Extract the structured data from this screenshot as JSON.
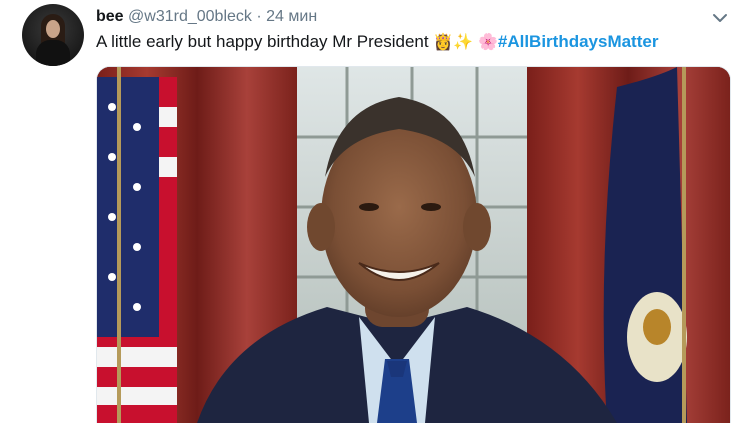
{
  "tweet": {
    "display_name": "bee",
    "handle": "@w31rd_00bleck",
    "separator": "·",
    "time": "24 мин",
    "text_prefix": "A little early but happy birthday Mr President",
    "emojis": [
      "👸",
      "✨",
      "🌸"
    ],
    "hashtag": "#AllBirthdaysMatter",
    "menu_icon": "chevron-down-icon",
    "media_description_icon": "photo"
  },
  "colors": {
    "text": "#14171a",
    "secondary": "#657786",
    "link": "#1b95e0",
    "curtain": "#8a2a22"
  }
}
